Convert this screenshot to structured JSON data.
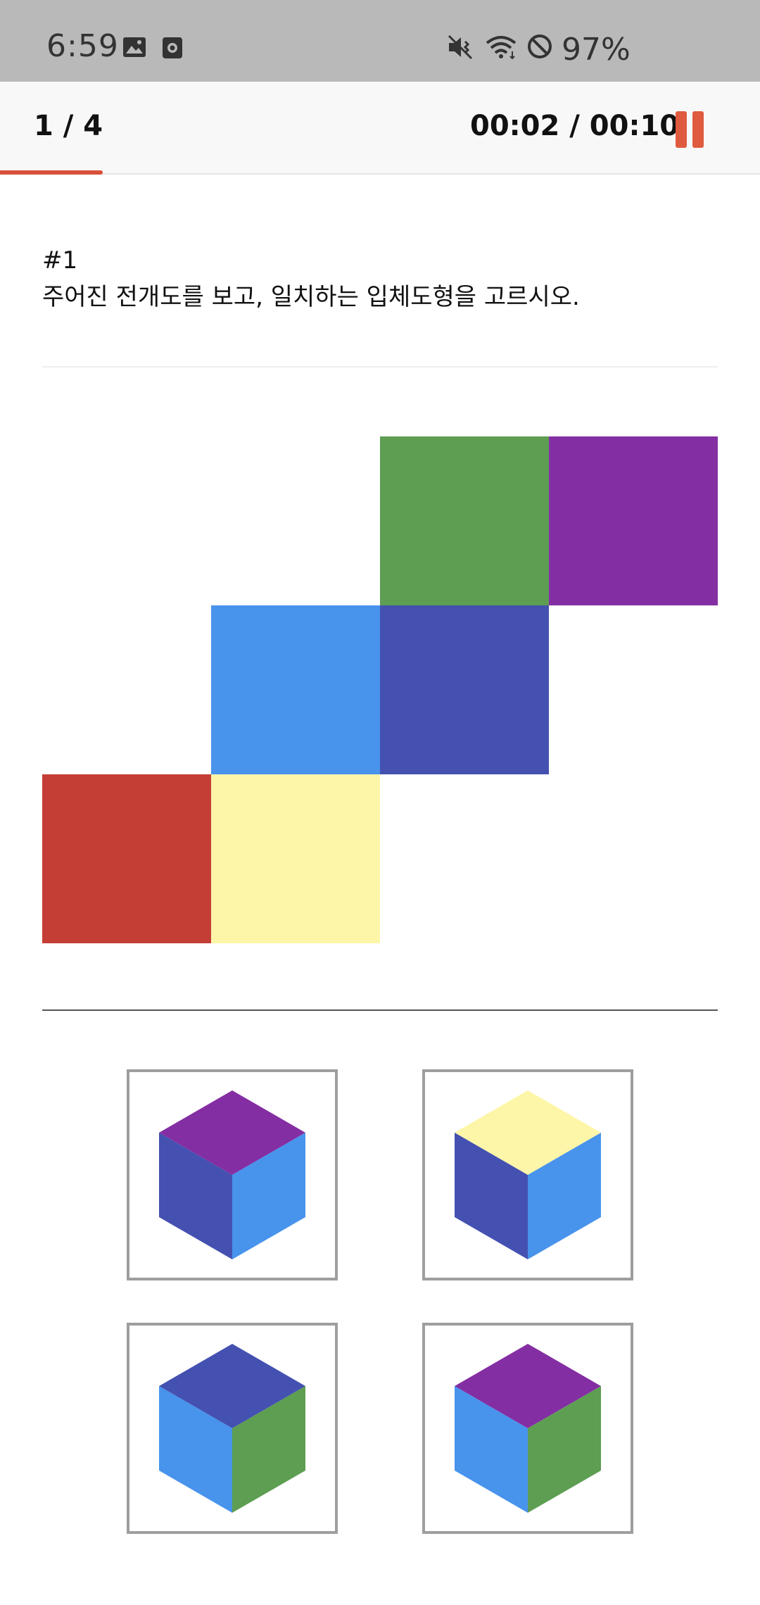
{
  "status_bar": {
    "time": "6:59",
    "icons": [
      "image-icon",
      "screen-record-icon",
      "mute-icon",
      "wifi-icon",
      "do-not-disturb-icon"
    ],
    "battery": "97%"
  },
  "header": {
    "counter": "1 / 4",
    "timer": "00:02 / 00:10",
    "progress": 0.135,
    "accent_color": "#e05a3f"
  },
  "question": {
    "number": "#1",
    "text": "주어진 전개도를 보고, 일치하는 입체도형을 고르시오."
  },
  "net": {
    "faces": [
      {
        "name": "green",
        "color": "#5d9e52"
      },
      {
        "name": "purple",
        "color": "#842ea3"
      },
      {
        "name": "light-blue",
        "color": "#4893ec"
      },
      {
        "name": "indigo",
        "color": "#4451b1"
      },
      {
        "name": "red",
        "color": "#c43e36"
      },
      {
        "name": "yellow",
        "color": "#fdf6a8"
      }
    ]
  },
  "options": [
    {
      "top": "#842ea3",
      "left": "#4451b1",
      "right": "#4893ec"
    },
    {
      "top": "#fdf6a8",
      "left": "#4451b1",
      "right": "#4893ec"
    },
    {
      "top": "#4451b1",
      "left": "#4893ec",
      "right": "#5d9e52"
    },
    {
      "top": "#842ea3",
      "left": "#4893ec",
      "right": "#5d9e52"
    }
  ]
}
